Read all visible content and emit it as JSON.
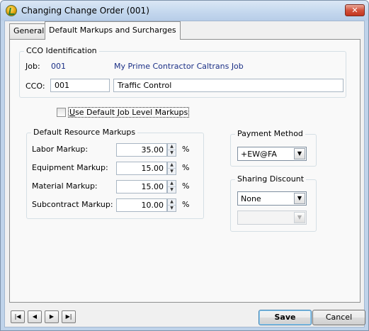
{
  "window": {
    "title": "Changing Change Order  (001)",
    "close_glyph": "✕"
  },
  "tabs": [
    {
      "label": "General"
    },
    {
      "label": "Default Markups and Surcharges"
    }
  ],
  "cco_identification": {
    "title": "CCO Identification",
    "job_label": "Job:",
    "job_number": "001",
    "job_name": "My Prime Contractor Caltrans Job",
    "cco_label": "CCO:",
    "cco_number": "001",
    "cco_description": "Traffic Control"
  },
  "use_default_checkbox": {
    "label": "Use Default Job Level Markups",
    "checked": false
  },
  "resource_markups": {
    "title": "Default Resource Markups",
    "rows": [
      {
        "label": "Labor Markup:",
        "value": "35.00",
        "unit": "%"
      },
      {
        "label": "Equipment Markup:",
        "value": "15.00",
        "unit": "%"
      },
      {
        "label": "Material Markup:",
        "value": "15.00",
        "unit": "%"
      },
      {
        "label": "Subcontract Markup:",
        "value": "10.00",
        "unit": "%"
      }
    ]
  },
  "payment_method": {
    "title": "Payment Method",
    "selected": "+EW@FA"
  },
  "sharing_discount": {
    "title": "Sharing Discount",
    "selected": "None",
    "secondary_value": ""
  },
  "footer": {
    "nav": [
      "first-record-icon",
      "previous-record-icon",
      "next-record-icon",
      "last-record-icon"
    ],
    "save_label": "Save",
    "cancel_label": "Cancel"
  }
}
